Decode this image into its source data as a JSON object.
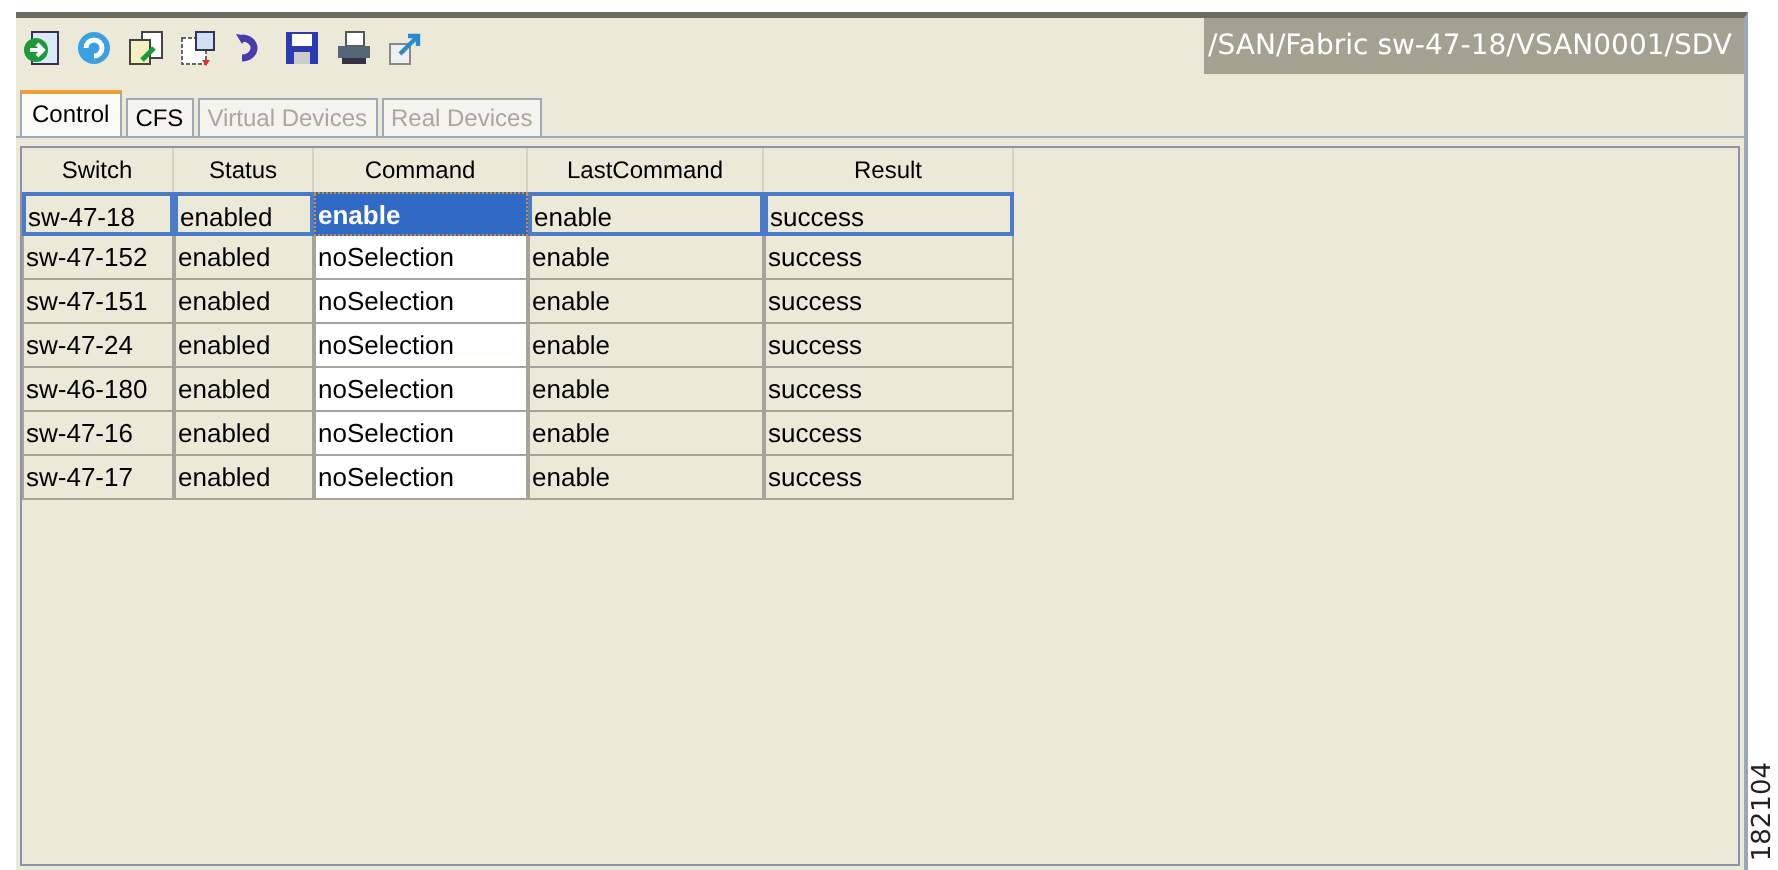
{
  "toolbar": {
    "buttons": [
      {
        "kind": "apply"
      },
      {
        "kind": "refresh"
      },
      {
        "kind": "copy"
      },
      {
        "kind": "paste"
      },
      {
        "kind": "undo"
      },
      {
        "kind": "save"
      },
      {
        "kind": "print"
      },
      {
        "kind": "export"
      }
    ]
  },
  "path": "/SAN/Fabric sw-47-18/VSAN0001/SDV",
  "tabs": [
    {
      "label": "Control",
      "selected": true,
      "disabled": false
    },
    {
      "label": "CFS",
      "selected": false,
      "disabled": false
    },
    {
      "label": "Virtual Devices",
      "selected": false,
      "disabled": true
    },
    {
      "label": "Real Devices",
      "selected": false,
      "disabled": true
    }
  ],
  "table": {
    "columns": [
      "Switch",
      "Status",
      "Command",
      "LastCommand",
      "Result"
    ],
    "rows": [
      {
        "cells": [
          "sw-47-18",
          "enabled",
          "enable",
          "enable",
          "success"
        ],
        "selected": true
      },
      {
        "cells": [
          "sw-47-152",
          "enabled",
          "noSelection",
          "enable",
          "success"
        ],
        "selected": false
      },
      {
        "cells": [
          "sw-47-151",
          "enabled",
          "noSelection",
          "enable",
          "success"
        ],
        "selected": false
      },
      {
        "cells": [
          "sw-47-24",
          "enabled",
          "noSelection",
          "enable",
          "success"
        ],
        "selected": false
      },
      {
        "cells": [
          "sw-46-180",
          "enabled",
          "noSelection",
          "enable",
          "success"
        ],
        "selected": false
      },
      {
        "cells": [
          "sw-47-16",
          "enabled",
          "noSelection",
          "enable",
          "success"
        ],
        "selected": false
      },
      {
        "cells": [
          "sw-47-17",
          "enabled",
          "noSelection",
          "enable",
          "success"
        ],
        "selected": false
      }
    ]
  },
  "figure_number": "182104"
}
